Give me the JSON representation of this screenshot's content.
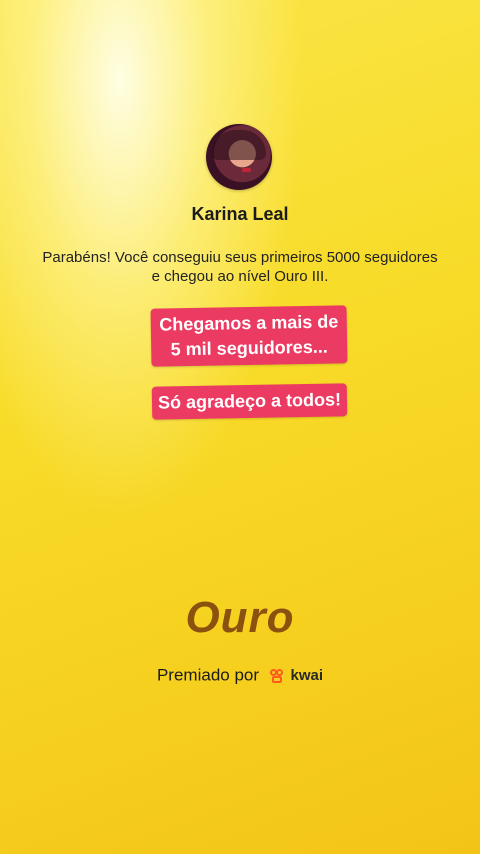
{
  "profile": {
    "name": "Karina Leal"
  },
  "message": "Parabéns! Você conseguiu seus primeiros 5000 seguidores e chegou ao nível Ouro III.",
  "stickers": [
    {
      "line1": "Chegamos a mais de",
      "line2": "5 mil seguidores..."
    },
    {
      "text": "Só agradeço a todos!"
    }
  ],
  "level": {
    "title": "Ouro"
  },
  "award": {
    "prefix": "Premiado por",
    "brand": "kwai",
    "brand_icon": "kwai-logo-icon"
  },
  "colors": {
    "sticker_bg": "#ec3b62",
    "level_text": "#8b520f",
    "background": "#f8dc2a",
    "brand": "#ff5a1f"
  }
}
